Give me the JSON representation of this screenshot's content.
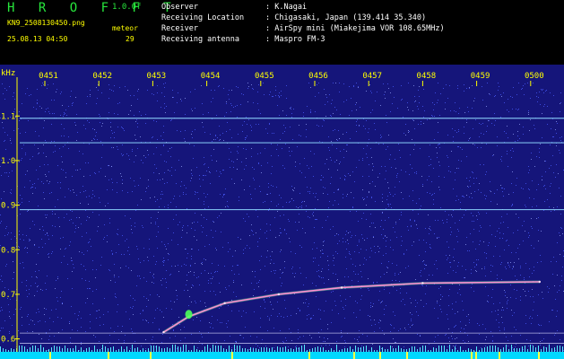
{
  "header": {
    "logo": "H R O F F T",
    "version": "1.0.0f",
    "filename": "KN9_2508130450.png",
    "meteor_label": "meteor",
    "datetime": "25.08.13 04:50",
    "meteor_count": "29",
    "info": [
      {
        "label": "Observer",
        "value": ": K.Nagai"
      },
      {
        "label": "Receiving Location",
        "value": ": Chigasaki, Japan (139.414 35.340)"
      },
      {
        "label": "Receiver",
        "value": ": AirSpy mini (Miakejima VOR 108.65MHz)"
      },
      {
        "label": "Receiving antenna",
        "value": ": Maspro FM-3"
      }
    ]
  },
  "chart_data": {
    "type": "heatmap",
    "ylabel": "kHz",
    "yticks": [
      "1.1",
      "1.0",
      "0.9",
      "0.8",
      "0.7",
      "0.6"
    ],
    "ytick_values": [
      1.1,
      1.0,
      0.9,
      0.8,
      0.7,
      0.6
    ],
    "xticks": [
      "0451",
      "0452",
      "0453",
      "0454",
      "0455",
      "0456",
      "0457",
      "0458",
      "0459",
      "0500"
    ],
    "ylim": [
      0.575,
      1.175
    ],
    "steady_lines_khz": [
      1.095,
      1.04,
      0.89
    ],
    "lower_lines_khz": [
      0.613,
      0.59
    ],
    "echo_trace": [
      {
        "t": "04:53:12",
        "khz": 0.615
      },
      {
        "t": "04:53:40",
        "khz": 0.65
      },
      {
        "t": "04:54:20",
        "khz": 0.68
      },
      {
        "t": "04:55:20",
        "khz": 0.7
      },
      {
        "t": "04:56:30",
        "khz": 0.715
      },
      {
        "t": "04:58:00",
        "khz": 0.725
      },
      {
        "t": "05:00:10",
        "khz": 0.728
      }
    ],
    "colors": {
      "background": "#15157a",
      "noise": "#4a5cff",
      "lines": "#8fd7ff",
      "echo": "#ff8cd2",
      "axis_text": "#ffff00"
    }
  }
}
